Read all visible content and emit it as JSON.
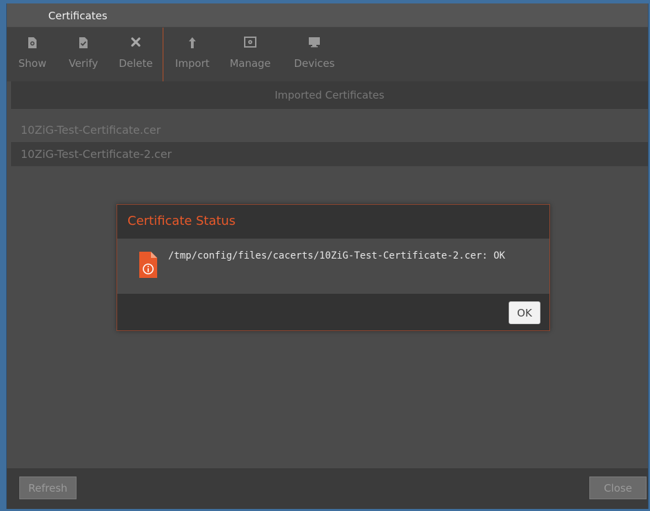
{
  "window": {
    "title": "Certificates"
  },
  "toolbar": {
    "items": [
      {
        "label": "Show",
        "icon": "show-certificate-icon"
      },
      {
        "label": "Verify",
        "icon": "verify-certificate-icon"
      },
      {
        "label": "Delete",
        "icon": "close-icon"
      },
      {
        "label": "Import",
        "icon": "arrow-up-icon"
      },
      {
        "label": "Manage",
        "icon": "manage-icon"
      },
      {
        "label": "Devices",
        "icon": "monitor-icon"
      }
    ]
  },
  "list": {
    "header": "Imported Certificates",
    "items": [
      {
        "label": "10ZiG-Test-Certificate.cer"
      },
      {
        "label": "10ZiG-Test-Certificate-2.cer"
      }
    ]
  },
  "dialog": {
    "title": "Certificate Status",
    "message": "/tmp/config/files/cacerts/10ZiG-Test-Certificate-2.cer: OK",
    "ok_label": "OK",
    "accent": "#e8592a"
  },
  "footer": {
    "refresh_label": "Refresh",
    "close_label": "Close"
  }
}
